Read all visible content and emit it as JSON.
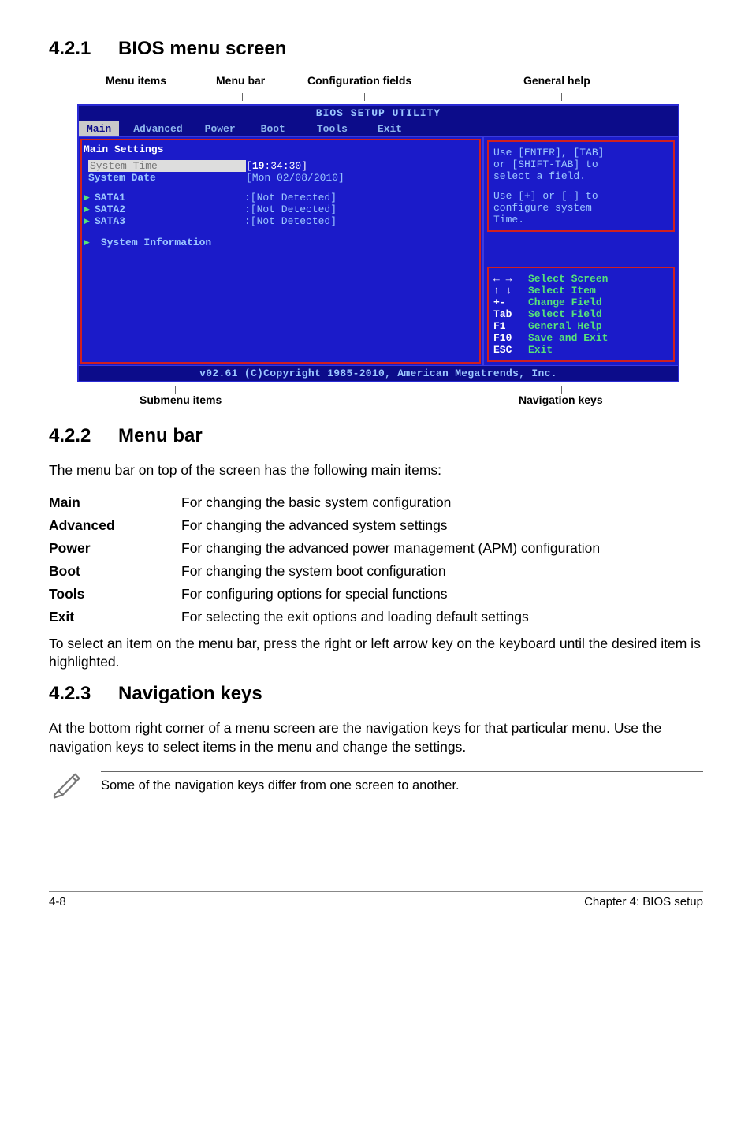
{
  "section1": {
    "num": "4.2.1",
    "title": "BIOS menu screen"
  },
  "labels": {
    "menu_items": "Menu items",
    "menu_bar": "Menu bar",
    "config_fields": "Configuration fields",
    "general_help": "General help",
    "submenu_items": "Submenu items",
    "nav_keys": "Navigation keys"
  },
  "bios": {
    "title": "BIOS SETUP UTILITY",
    "tabs": {
      "main": "Main",
      "advanced": "Advanced",
      "power": "Power",
      "boot": "Boot",
      "tools": "Tools",
      "exit": "Exit"
    },
    "heading": "Main Settings",
    "system_time_label": "System Time",
    "system_time_val_pre": "[",
    "system_time_val_hi": "19",
    "system_time_val_post": ":34:30]",
    "system_date_label": "System Date",
    "system_date_val": "[Mon 02/08/2010]",
    "sata1_label": "SATA1",
    "sata2_label": "SATA2",
    "sata3_label": "SATA3",
    "not_detected": ":[Not Detected]",
    "sysinfo": "System Information",
    "help_line1": "Use [ENTER], [TAB]",
    "help_line2": "or [SHIFT-TAB] to",
    "help_line3": "select a field.",
    "help_line4": "Use [+] or [-] to",
    "help_line5": "configure system",
    "help_line6": "Time.",
    "nav": {
      "arrows_desc": "Select Screen",
      "updown_desc": "Select Item",
      "pm_key": "+-",
      "pm_desc": "Change Field",
      "tab_key": "Tab",
      "tab_desc": "Select Field",
      "f1_key": "F1",
      "f1_desc": "General Help",
      "f10_key": "F10",
      "f10_desc": "Save and Exit",
      "esc_key": "ESC",
      "esc_desc": "Exit"
    },
    "footer": "v02.61 (C)Copyright 1985-2010, American Megatrends, Inc."
  },
  "section2": {
    "num": "4.2.2",
    "title": "Menu bar"
  },
  "menubar_intro": "The menu bar on top of the screen has the following main items:",
  "defs": {
    "main_term": "Main",
    "main_desc": "For changing the basic system configuration",
    "adv_term": "Advanced",
    "adv_desc": "For changing the advanced system settings",
    "pwr_term": "Power",
    "pwr_desc": "For changing the advanced power management (APM) configuration",
    "boot_term": "Boot",
    "boot_desc": "For changing the system boot configuration",
    "tools_term": "Tools",
    "tools_desc": "For configuring options for special functions",
    "exit_term": "Exit",
    "exit_desc": "For selecting the exit options and loading default settings"
  },
  "menubar_outro": "To select an item on the menu bar, press the right or left arrow key on the keyboard until the desired item is highlighted.",
  "section3": {
    "num": "4.2.3",
    "title": "Navigation keys"
  },
  "navkeys_para": "At the bottom right corner of a menu screen are the navigation keys for that particular menu. Use the navigation keys to select items in the menu and change the settings.",
  "note": "Some of the navigation keys differ from one screen to another.",
  "footer": {
    "left": "4-8",
    "right": "Chapter 4: BIOS setup"
  }
}
